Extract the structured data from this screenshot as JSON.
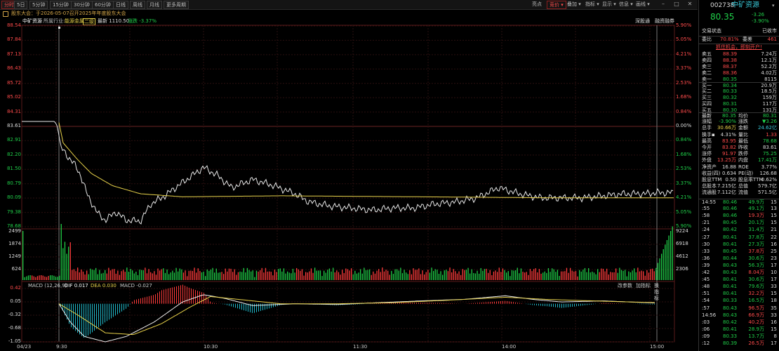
{
  "toolbar": {
    "tabs": [
      "分时",
      "5日",
      "5分钟",
      "15分钟",
      "30分钟",
      "60分钟",
      "日线",
      "周线",
      "月线",
      "更多周期"
    ],
    "active_tab": 0,
    "right_items": [
      "亮点",
      "竞价",
      "叠加",
      "指标",
      "显示",
      "信息",
      "画线"
    ],
    "active_right": 1
  },
  "announcement": "股东大会：于2026-05-07召开2025年年度股东大会",
  "header": {
    "name": "中矿资源",
    "industry_label": "所属行业:",
    "industry": "能源金属",
    "tag": "二级",
    "latest": "最新 1110.50",
    "change": "涨跌 -3.37%",
    "right1": "深股通",
    "right2": "融资融券"
  },
  "price_axis": {
    "left": [
      "88.54",
      "87.84",
      "87.13",
      "86.43",
      "85.72",
      "85.02",
      "84.31",
      "83.61",
      "82.91",
      "82.20",
      "81.50",
      "80.79",
      "80.09",
      "79.38",
      "78.68"
    ],
    "right": [
      "5.90%",
      "5.05%",
      "4.21%",
      "3.37%",
      "2.53%",
      "1.68%",
      "0.84%",
      "0.00%",
      "0.84%",
      "1.68%",
      "2.53%",
      "3.37%",
      "4.21%",
      "5.05%",
      "5.90%"
    ]
  },
  "volume_axis": {
    "left": [
      "2499",
      "1874",
      "1249",
      "624"
    ],
    "right": [
      "9224",
      "6918",
      "4612",
      "2306"
    ]
  },
  "macd": {
    "label": "MACD (12,26,9)",
    "dif": "DIF 0.017",
    "dea": "DEA 0.030",
    "macd": "MACD -0.027",
    "buttons": [
      "改参数",
      "加指标",
      "换指标"
    ],
    "axis": [
      "0.42",
      "0.05",
      "-0.32",
      "-0.68",
      "-1.05"
    ]
  },
  "time_axis": [
    "04/23",
    "9:30",
    "10:30",
    "11:30",
    "14:00",
    "15:00"
  ],
  "quote": {
    "code": "002738",
    "name": "中矿资源",
    "price": "80.35",
    "change": "-3.26",
    "pct": "-3.90%",
    "status_label": "交易状态",
    "status": "已收市",
    "webi_label": "委比",
    "webi": "70.81%",
    "weicha_label": "委差",
    "weicha": "461",
    "promo": "抓住机会，即刻开户!",
    "asks": [
      {
        "label": "卖五",
        "price": "88.39",
        "vol": "7.24万"
      },
      {
        "label": "卖四",
        "price": "88.38",
        "vol": "12.1万"
      },
      {
        "label": "卖三",
        "price": "88.37",
        "vol": "52.2万"
      },
      {
        "label": "卖二",
        "price": "88.36",
        "vol": "4.02万"
      },
      {
        "label": "卖一",
        "price": "80.35",
        "vol": "8115"
      }
    ],
    "bids": [
      {
        "label": "买一",
        "price": "80.34",
        "vol": "20.9万"
      },
      {
        "label": "买二",
        "price": "80.33",
        "vol": "18.5万"
      },
      {
        "label": "买三",
        "price": "80.32",
        "vol": "159万"
      },
      {
        "label": "买四",
        "price": "80.31",
        "vol": "117万"
      },
      {
        "label": "买五",
        "price": "80.30",
        "vol": "131万"
      }
    ],
    "stats": [
      {
        "l1": "最新",
        "v1": "80.35",
        "c1": "grn",
        "l2": "均价",
        "v2": "80.31",
        "c2": "grn"
      },
      {
        "l1": "涨幅",
        "v1": "-3.90%",
        "c1": "grn",
        "l2": "涨跌",
        "v2": "▼3.26",
        "c2": "grn"
      },
      {
        "l1": "总手",
        "v1": "30.66万",
        "c1": "yel",
        "l2": "金额",
        "v2": "24.62亿",
        "c2": "cy"
      },
      {
        "l1": "换手▪",
        "v1": "4.31%",
        "c1": "wht",
        "l2": "量比",
        "v2": "1.33",
        "c2": "red"
      },
      {
        "l1": "最高",
        "v1": "83.95",
        "c1": "red",
        "l2": "最低",
        "v2": "78.68",
        "c2": "grn"
      },
      {
        "l1": "今开",
        "v1": "83.82",
        "c1": "red",
        "l2": "昨收",
        "v2": "83.61",
        "c2": "wht"
      },
      {
        "l1": "涨停",
        "v1": "91.97",
        "c1": "red",
        "l2": "跌停",
        "v2": "75.25",
        "c2": "grn"
      },
      {
        "l1": "外盘",
        "v1": "13.25万",
        "c1": "red",
        "l2": "内盘",
        "v2": "17.41万",
        "c2": "grn"
      },
      {
        "l1": "净资产",
        "v1": "16.88",
        "c1": "wht",
        "l2": "ROE",
        "v2": "3.77%",
        "c2": "wht"
      },
      {
        "l1": "收益(四)",
        "v1": "0.634",
        "c1": "wht",
        "l2": "PE(动)",
        "v2": "126.68",
        "c2": "wht"
      },
      {
        "l1": "股息TTM",
        "v1": "0.50",
        "c1": "wht",
        "l2": "股息率TTM",
        "v2": "0.62%",
        "c2": "wht"
      },
      {
        "l1": "总股本",
        "v1": "7.215亿",
        "c1": "wht",
        "l2": "总值",
        "v2": "579.7亿",
        "c2": "wht"
      },
      {
        "l1": "流通股",
        "v1": "7.112亿",
        "c1": "wht",
        "l2": "流值",
        "v2": "571.5亿",
        "c2": "wht"
      }
    ],
    "ticks": [
      {
        "t": "14:55",
        "p": "80.46",
        "v": "49.9万",
        "n": "15",
        "pc": "grn",
        "vc": "grn"
      },
      {
        "t": ":55",
        "p": "80.46",
        "v": "49.1万",
        "n": "13",
        "pc": "grn",
        "vc": "grn"
      },
      {
        "t": ":58",
        "p": "80.46",
        "v": "19.3万",
        "n": "15",
        "pc": "grn",
        "vc": "red"
      },
      {
        "t": ":21",
        "p": "80.45",
        "v": "20.1万",
        "n": "15",
        "pc": "grn",
        "vc": "grn"
      },
      {
        "t": ":24",
        "p": "80.42",
        "v": "31.4万",
        "n": "21",
        "pc": "grn",
        "vc": "grn"
      },
      {
        "t": ":27",
        "p": "80.41",
        "v": "37.8万",
        "n": "22",
        "pc": "grn",
        "vc": "grn"
      },
      {
        "t": ":30",
        "p": "80.41",
        "v": "27.3万",
        "n": "16",
        "pc": "grn",
        "vc": "grn"
      },
      {
        "t": ":33",
        "p": "80.45",
        "v": "37.8万",
        "n": "25",
        "pc": "grn",
        "vc": "red"
      },
      {
        "t": ":36",
        "p": "80.44",
        "v": "30.6万",
        "n": "23",
        "pc": "grn",
        "vc": "grn"
      },
      {
        "t": ":39",
        "p": "80.43",
        "v": "56.3万",
        "n": "17",
        "pc": "grn",
        "vc": "grn"
      },
      {
        "t": ":42",
        "p": "80.43",
        "v": "8.04万",
        "n": "10",
        "pc": "grn",
        "vc": "red"
      },
      {
        "t": ":45",
        "p": "80.41",
        "v": "30.6万",
        "n": "17",
        "pc": "grn",
        "vc": "grn"
      },
      {
        "t": ":48",
        "p": "80.41",
        "v": "79.6万",
        "n": "33",
        "pc": "grn",
        "vc": "grn"
      },
      {
        "t": ":51",
        "p": "80.41",
        "v": "32.2万",
        "n": "15",
        "pc": "grn",
        "vc": "red"
      },
      {
        "t": ":54",
        "p": "80.33",
        "v": "16.5万",
        "n": "18",
        "pc": "grn",
        "vc": "grn"
      },
      {
        "t": ":57",
        "p": "80.43",
        "v": "96.5万",
        "n": "35",
        "pc": "grn",
        "vc": "red"
      },
      {
        "t": "14:56",
        "p": "80.43",
        "v": "66.9万",
        "n": "33",
        "pc": "grn",
        "vc": "red"
      },
      {
        "t": ":03",
        "p": "80.42",
        "v": "40.2万",
        "n": "16",
        "pc": "grn",
        "vc": "red"
      },
      {
        "t": ":06",
        "p": "80.41",
        "v": "28.9万",
        "n": "15",
        "pc": "grn",
        "vc": "grn"
      },
      {
        "t": ":09",
        "p": "80.33",
        "v": "13.7万",
        "n": "8",
        "pc": "grn",
        "vc": "grn"
      },
      {
        "t": ":12",
        "p": "80.39",
        "v": "26.5万",
        "n": "17",
        "pc": "grn",
        "vc": "red"
      }
    ]
  }
}
